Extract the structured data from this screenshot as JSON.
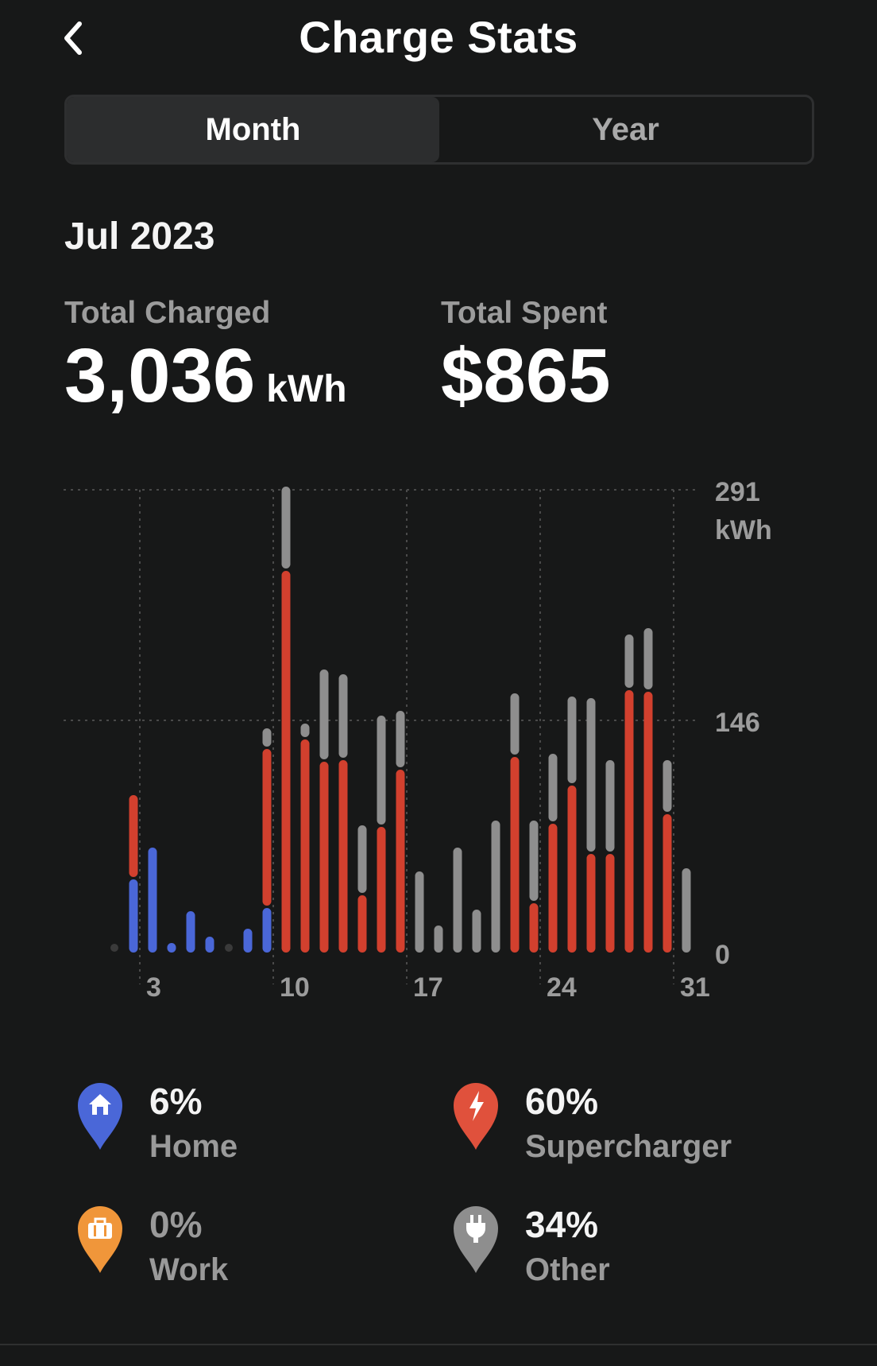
{
  "header": {
    "title": "Charge Stats",
    "back_icon": "chevron-left-icon"
  },
  "tabs": [
    {
      "label": "Month",
      "active": true
    },
    {
      "label": "Year",
      "active": false
    }
  ],
  "period": "Jul 2023",
  "stats": {
    "total_charged_label": "Total Charged",
    "total_charged_value": "3,036",
    "total_charged_unit": "kWh",
    "total_spent_label": "Total Spent",
    "total_spent_value": "$865"
  },
  "legend": [
    {
      "pct": "6%",
      "name": "Home",
      "icon": "home-icon",
      "color": "#4a67d8"
    },
    {
      "pct": "60%",
      "name": "Supercharger",
      "icon": "lightning-icon",
      "color": "#e0513c"
    },
    {
      "pct": "0%",
      "name": "Work",
      "icon": "briefcase-icon",
      "color": "#f0963a"
    },
    {
      "pct": "34%",
      "name": "Other",
      "icon": "plug-icon",
      "color": "#8e8e8e"
    }
  ],
  "colors": {
    "background": "#171818",
    "home": "#4a67d8",
    "supercharger": "#d2402e",
    "work": "#f0963a",
    "other": "#8e8e8e",
    "gridline": "#4a4a4a"
  },
  "chart_data": {
    "type": "bar",
    "stacked": true,
    "xlabel": "",
    "ylabel": "kWh",
    "ylim": [
      0,
      291
    ],
    "y_ticks": [
      {
        "value": 0,
        "label": "0"
      },
      {
        "value": 146,
        "label": "146"
      },
      {
        "value": 291,
        "label": "291"
      }
    ],
    "y_unit_label": "kWh",
    "x_ticks": [
      {
        "day": 3,
        "label": "3"
      },
      {
        "day": 10,
        "label": "10"
      },
      {
        "day": 17,
        "label": "17"
      },
      {
        "day": 24,
        "label": "24"
      },
      {
        "day": 31,
        "label": "31"
      }
    ],
    "categories": [
      1,
      2,
      3,
      4,
      5,
      6,
      7,
      8,
      9,
      10,
      11,
      12,
      13,
      14,
      15,
      16,
      17,
      18,
      19,
      20,
      21,
      22,
      23,
      24,
      25,
      26,
      27,
      28,
      29,
      30,
      31
    ],
    "series": [
      {
        "name": "Home",
        "color": "#4a67d8",
        "values": [
          0,
          46,
          66,
          6,
          26,
          10,
          0,
          15,
          28,
          0,
          0,
          0,
          0,
          0,
          0,
          0,
          0,
          0,
          0,
          0,
          0,
          0,
          0,
          0,
          0,
          0,
          0,
          0,
          0,
          0,
          0
        ]
      },
      {
        "name": "Supercharger",
        "color": "#d2402e",
        "values": [
          0,
          53,
          0,
          0,
          0,
          0,
          0,
          0,
          100,
          240,
          134,
          120,
          121,
          36,
          79,
          115,
          0,
          0,
          0,
          0,
          0,
          123,
          31,
          81,
          105,
          62,
          62,
          165,
          164,
          87,
          0
        ]
      },
      {
        "name": "Other",
        "color": "#8e8e8e",
        "values": [
          0,
          0,
          0,
          0,
          0,
          0,
          0,
          0,
          13,
          53,
          10,
          58,
          54,
          44,
          70,
          37,
          51,
          17,
          66,
          27,
          83,
          40,
          52,
          44,
          56,
          98,
          59,
          35,
          40,
          34,
          53
        ]
      }
    ],
    "empty_day_markers": [
      1,
      7
    ]
  }
}
